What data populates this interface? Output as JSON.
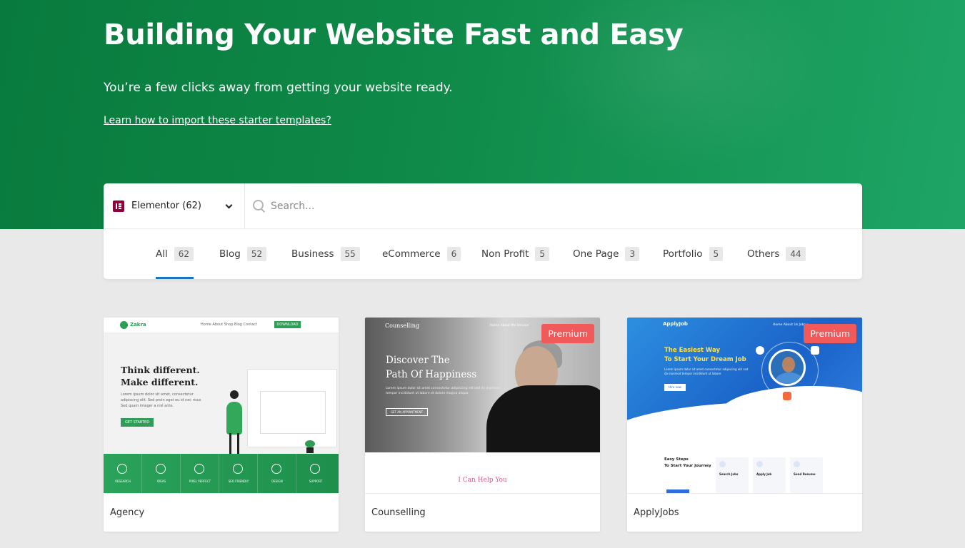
{
  "hero": {
    "title": "Building Your Website Fast and Easy",
    "subtitle": "You’re a few clicks away from getting your website ready.",
    "link": "Learn how to import these starter templates?"
  },
  "builder": {
    "label": "Elementor (62)",
    "icon": "elementor-icon"
  },
  "search": {
    "placeholder": "Search...",
    "value": ""
  },
  "tabs": [
    {
      "label": "All",
      "count": "62",
      "active": true
    },
    {
      "label": "Blog",
      "count": "52",
      "active": false
    },
    {
      "label": "Business",
      "count": "55",
      "active": false
    },
    {
      "label": "eCommerce",
      "count": "6",
      "active": false
    },
    {
      "label": "Non Profit",
      "count": "5",
      "active": false
    },
    {
      "label": "One Page",
      "count": "3",
      "active": false
    },
    {
      "label": "Portfolio",
      "count": "5",
      "active": false
    },
    {
      "label": "Others",
      "count": "44",
      "active": false
    }
  ],
  "templates": [
    {
      "name": "Agency",
      "premium": false,
      "preview": {
        "brand": "Zakra",
        "menu": "Home   About   Shop   Blog   Contact",
        "cta": "DOWNLOAD",
        "headline": [
          "Think different.",
          "Make different."
        ],
        "text": [
          "Lorem ipsum dolor sit amet, consectetur",
          "adipiscing elit. Sed proin eget eu id nec risus",
          "Sed quam integer a nisl ante."
        ],
        "button": "GET STARTED",
        "features": [
          "RESEARCH",
          "IDEAS",
          "PIXEL PERFECT",
          "SEO FRIENDLY",
          "DESIGN",
          "SUPPORT"
        ]
      }
    },
    {
      "name": "Counselling",
      "premium": true,
      "badge": "Premium",
      "preview": {
        "brand": "Counselling",
        "menu": "Home   About Me   Service",
        "headline": [
          "Discover The",
          "Path Of Happiness"
        ],
        "text": "Lorem ipsum dolor sit amet consectetur adipiscing elit sed do eiusmod tempor incididunt ut labore et dolore magna aliqua",
        "button": "GET AN APPOINTMENT",
        "section": "I Can Help You"
      }
    },
    {
      "name": "ApplyJobs",
      "premium": true,
      "badge": "Premium",
      "preview": {
        "brand": "ApplyJob",
        "menu": "Home   About Us   Jobs ▾",
        "headline": [
          "The Easiest Way",
          "To Start Your Dream Job"
        ],
        "text": "Lorem ipsum dolor sit amet consectetur adipiscing elit sed do eiusmod tempor incididunt ut labore",
        "button": "Hire now",
        "steps": [
          "Easy Steps",
          "To Start Your Journey"
        ],
        "boxes": [
          "Search Jobs",
          "Apply Job",
          "Send Resume"
        ]
      }
    }
  ],
  "colors": {
    "hero_start": "#087a3d",
    "hero_end": "#1ea566",
    "active_tab": "#1e73be",
    "premium_badge": "#f05a5a"
  }
}
